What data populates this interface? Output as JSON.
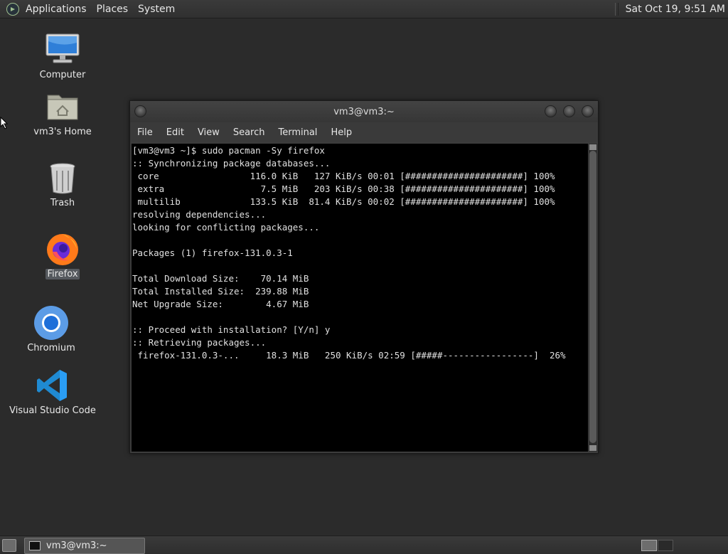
{
  "top_panel": {
    "menus": [
      "Applications",
      "Places",
      "System"
    ],
    "clock": "Sat Oct 19,  9:51 AM"
  },
  "desktop": {
    "icons": [
      {
        "label": "Computer",
        "icon": "computer-icon"
      },
      {
        "label": "vm3's Home",
        "icon": "home-folder-icon"
      },
      {
        "label": "Trash",
        "icon": "trash-icon"
      },
      {
        "label": "Firefox",
        "icon": "firefox-icon"
      },
      {
        "label": "Chromium",
        "icon": "chromium-icon"
      },
      {
        "label": "Visual Studio Code",
        "icon": "vscode-icon"
      }
    ]
  },
  "terminal_window": {
    "title": "vm3@vm3:~",
    "menu": [
      "File",
      "Edit",
      "View",
      "Search",
      "Terminal",
      "Help"
    ],
    "lines": [
      "[vm3@vm3 ~]$ sudo pacman -Sy firefox",
      ":: Synchronizing package databases...",
      " core                 116.0 KiB   127 KiB/s 00:01 [######################] 100%",
      " extra                  7.5 MiB   203 KiB/s 00:38 [######################] 100%",
      " multilib             133.5 KiB  81.4 KiB/s 00:02 [######################] 100%",
      "resolving dependencies...",
      "looking for conflicting packages...",
      "",
      "Packages (1) firefox-131.0.3-1",
      "",
      "Total Download Size:    70.14 MiB",
      "Total Installed Size:  239.88 MiB",
      "Net Upgrade Size:        4.67 MiB",
      "",
      ":: Proceed with installation? [Y/n] y",
      ":: Retrieving packages...",
      " firefox-131.0.3-...     18.3 MiB   250 KiB/s 02:59 [#####-----------------]  26%"
    ]
  },
  "bottom_panel": {
    "task_label": "vm3@vm3:~"
  }
}
